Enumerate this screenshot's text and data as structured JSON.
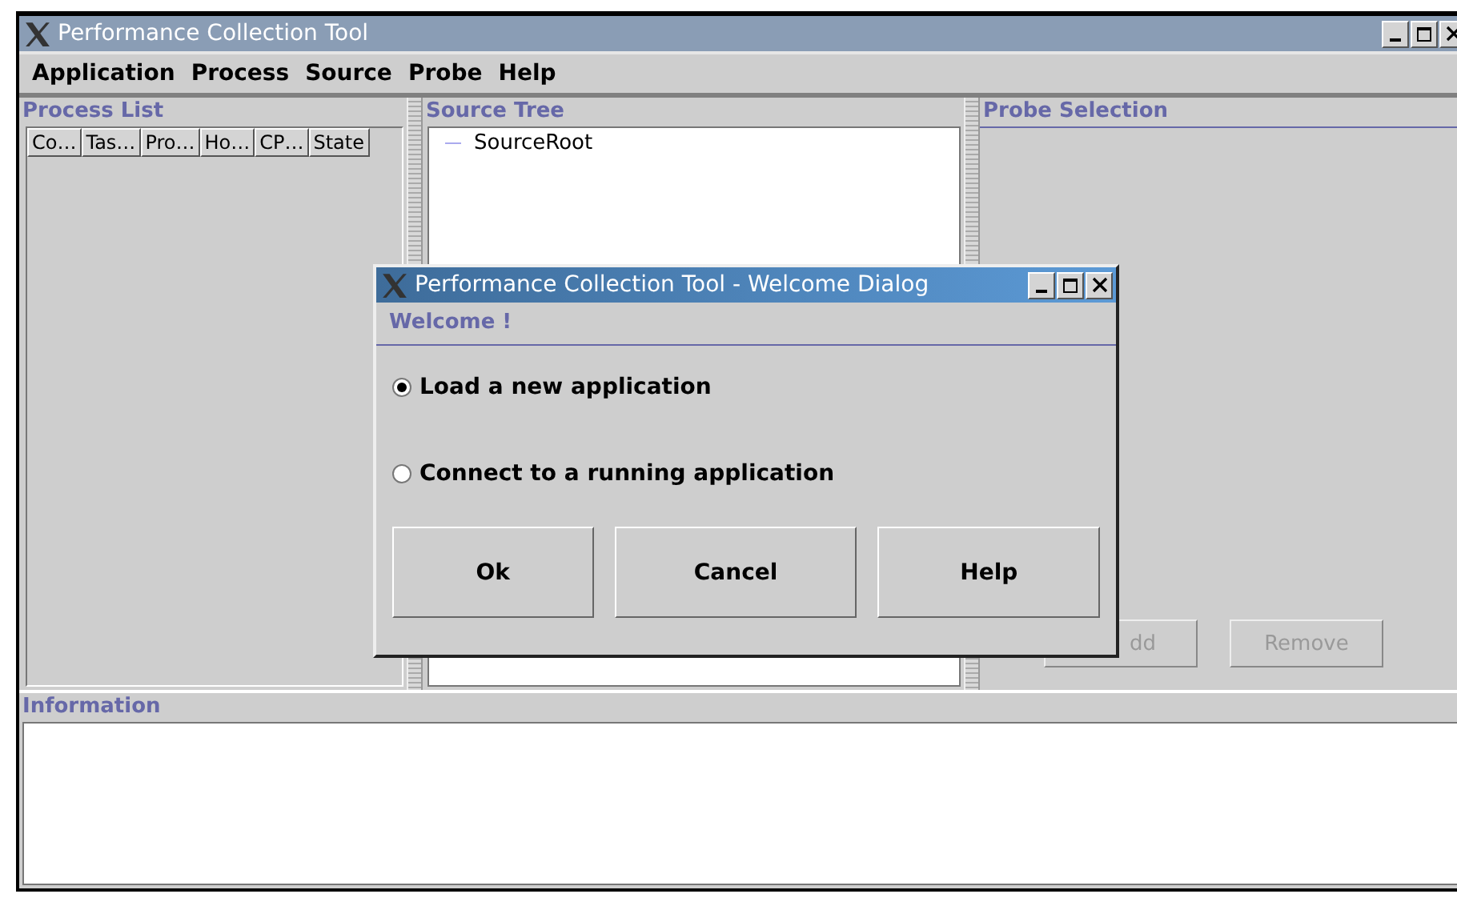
{
  "window": {
    "title": "Performance Collection Tool"
  },
  "menu": [
    {
      "label": "Application"
    },
    {
      "label": "Process"
    },
    {
      "label": "Source"
    },
    {
      "label": "Probe"
    },
    {
      "label": "Help"
    }
  ],
  "process_list": {
    "title": "Process List",
    "columns": [
      "Co…",
      "Tas…",
      "Pro…",
      "Ho…",
      "CP…",
      "State"
    ]
  },
  "source_tree": {
    "title": "Source Tree",
    "items": [
      {
        "label": "SourceRoot"
      }
    ]
  },
  "probe_selection": {
    "title": "Probe Selection",
    "buttons": [
      {
        "label": "dd",
        "disabled": true
      },
      {
        "label": "Remove",
        "disabled": true
      }
    ]
  },
  "information": {
    "title": "Information"
  },
  "dialog": {
    "title": "Performance Collection Tool - Welcome Dialog",
    "heading": "Welcome !",
    "options": [
      {
        "label": "Load a new application",
        "selected": true
      },
      {
        "label": "Connect to a running application",
        "selected": false
      }
    ],
    "buttons": [
      {
        "label": "Ok"
      },
      {
        "label": "Cancel"
      },
      {
        "label": "Help"
      }
    ]
  }
}
